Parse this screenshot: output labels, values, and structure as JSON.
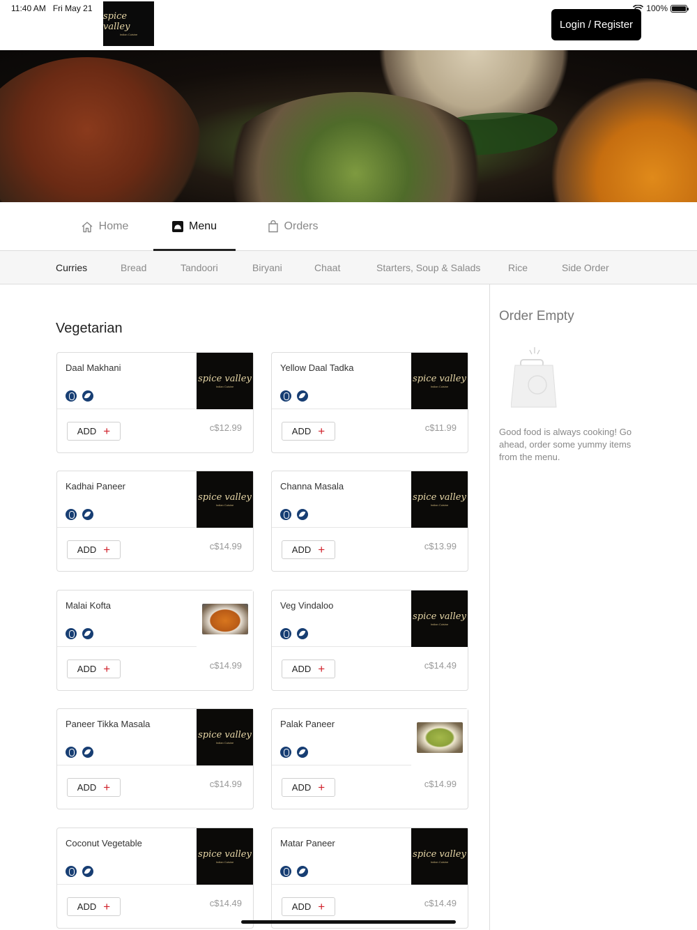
{
  "status_bar": {
    "time": "11:40 AM",
    "date": "Fri May 21",
    "battery": "100%"
  },
  "brand": {
    "logo_text": "spice valley",
    "logo_subtext": "Indian Cuisine"
  },
  "header": {
    "login_label": "Login / Register"
  },
  "nav": {
    "tabs": [
      {
        "label": "Home",
        "icon": "home-icon",
        "active": false
      },
      {
        "label": "Menu",
        "icon": "menu-icon",
        "active": true
      },
      {
        "label": "Orders",
        "icon": "bag-icon",
        "active": false
      }
    ]
  },
  "categories": [
    {
      "label": "Curries",
      "active": true
    },
    {
      "label": "Bread",
      "active": false
    },
    {
      "label": "Tandoori",
      "active": false
    },
    {
      "label": "Biryani",
      "active": false
    },
    {
      "label": "Chaat",
      "active": false
    },
    {
      "label": "Starters, Soup & Salads",
      "active": false
    },
    {
      "label": "Rice",
      "active": false
    },
    {
      "label": "Side Order",
      "active": false
    }
  ],
  "menu": {
    "section_title": "Vegetarian",
    "add_label": "ADD",
    "items": [
      {
        "name": "Daal Makhani",
        "price": "c$12.99",
        "image": "logo"
      },
      {
        "name": "Yellow Daal Tadka",
        "price": "c$11.99",
        "image": "logo"
      },
      {
        "name": "Kadhai Paneer",
        "price": "c$14.99",
        "image": "logo"
      },
      {
        "name": "Channa Masala",
        "price": "c$13.99",
        "image": "logo"
      },
      {
        "name": "Malai Kofta",
        "price": "c$14.99",
        "image": "curry-photo"
      },
      {
        "name": "Veg Vindaloo",
        "price": "c$14.49",
        "image": "logo"
      },
      {
        "name": "Paneer Tikka Masala",
        "price": "c$14.99",
        "image": "logo"
      },
      {
        "name": "Palak Paneer",
        "price": "c$14.99",
        "image": "palak-photo"
      },
      {
        "name": "Coconut Vegetable",
        "price": "c$14.49",
        "image": "logo"
      },
      {
        "name": "Matar Paneer",
        "price": "c$14.49",
        "image": "logo"
      }
    ]
  },
  "order": {
    "title": "Order Empty",
    "message": "Good food is always cooking! Go ahead, order some yummy items from the menu."
  },
  "colors": {
    "accent": "#000000",
    "diet_icon": "#173e73",
    "plus": "#d0202a"
  }
}
